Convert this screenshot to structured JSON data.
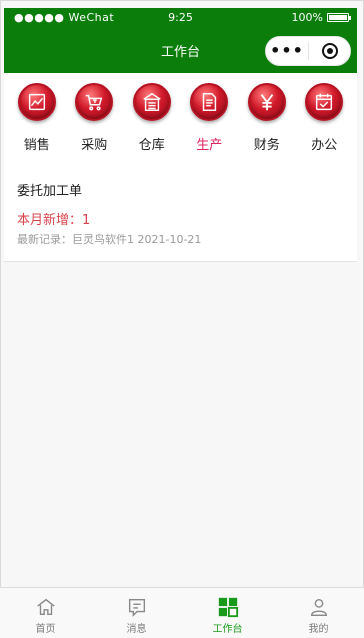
{
  "status_bar": {
    "carrier": "●●●●● WeChat",
    "time": "9:25",
    "battery_text": "100%"
  },
  "nav": {
    "title": "工作台",
    "more_label": "•••"
  },
  "menu": {
    "items": [
      {
        "label": "销售",
        "icon": "chart-icon"
      },
      {
        "label": "采购",
        "icon": "cart-icon"
      },
      {
        "label": "仓库",
        "icon": "warehouse-icon"
      },
      {
        "label": "生产",
        "icon": "document-icon"
      },
      {
        "label": "财务",
        "icon": "yen-icon"
      },
      {
        "label": "办公",
        "icon": "office-icon"
      }
    ],
    "active_index": 3
  },
  "card": {
    "title": "委托加工单",
    "new_this_month": "本月新增：1",
    "latest_record": "最新记录：巨灵鸟软件1 2021-10-21"
  },
  "tabbar": {
    "items": [
      {
        "label": "首页",
        "icon": "home-icon"
      },
      {
        "label": "消息",
        "icon": "message-icon"
      },
      {
        "label": "工作台",
        "icon": "workbench-icon"
      },
      {
        "label": "我的",
        "icon": "profile-icon"
      }
    ],
    "active_index": 2
  },
  "colors": {
    "brand_green": "#0a7d0a",
    "tab_active": "#1a9a1a",
    "icon_red": "#d1192a",
    "highlight_red": "#d9434b",
    "menu_active": "#e0245e"
  }
}
